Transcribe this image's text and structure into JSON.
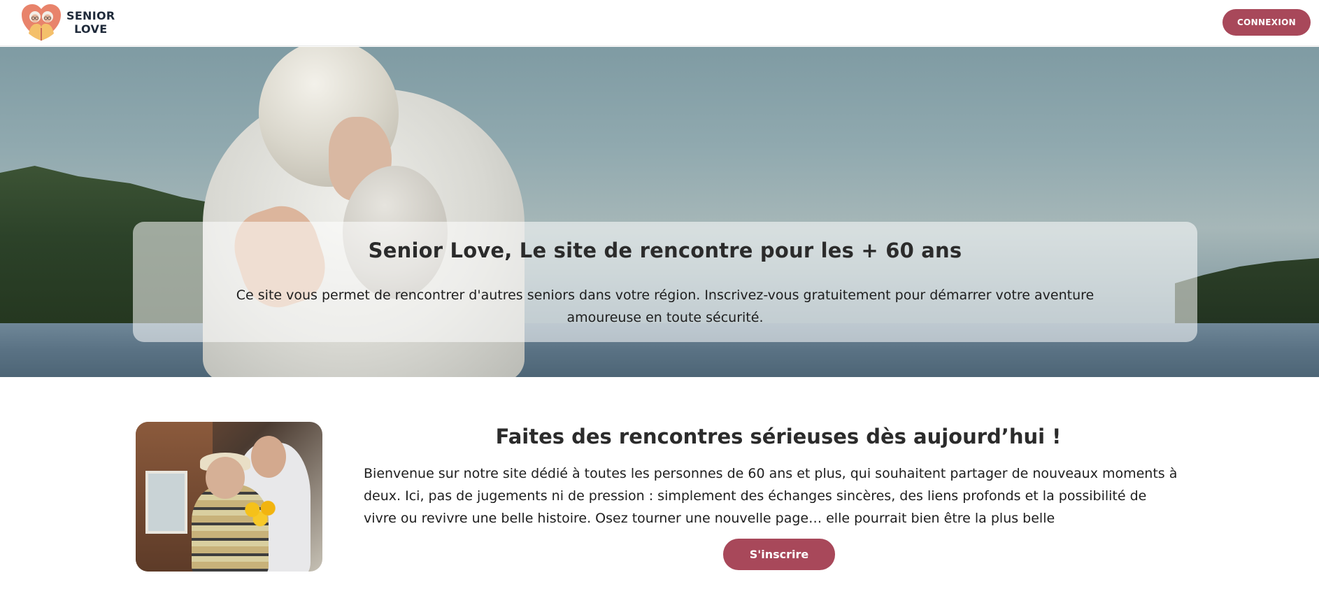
{
  "header": {
    "logo_line1": "SENIOR",
    "logo_line2": "LOVE",
    "login_label": "CONNEXION"
  },
  "hero": {
    "title": "Senior Love, Le site de rencontre pour les + 60 ans",
    "description": "Ce site vous permet de rencontrer d'autres seniors dans votre région. Inscrivez-vous gratuitement pour démarrer votre aventure amoureuse en toute sécurité."
  },
  "intro": {
    "title": "Faites des rencontres sérieuses dès aujourd’hui !",
    "text": "Bienvenue sur notre site dédié à toutes les personnes de 60 ans et plus, qui souhaitent partager de nouveaux moments à deux. Ici, pas de jugements ni de pression : simplement des échanges sincères, des liens profonds et la possibilité de vivre ou revivre une belle histoire. Osez tourner une nouvelle page… elle pourrait bien être la plus belle",
    "signup_label": "S'inscrire"
  },
  "colors": {
    "accent": "#a8485a",
    "logo_heart": "#e8836b",
    "logo_text": "#1f2a3a"
  }
}
